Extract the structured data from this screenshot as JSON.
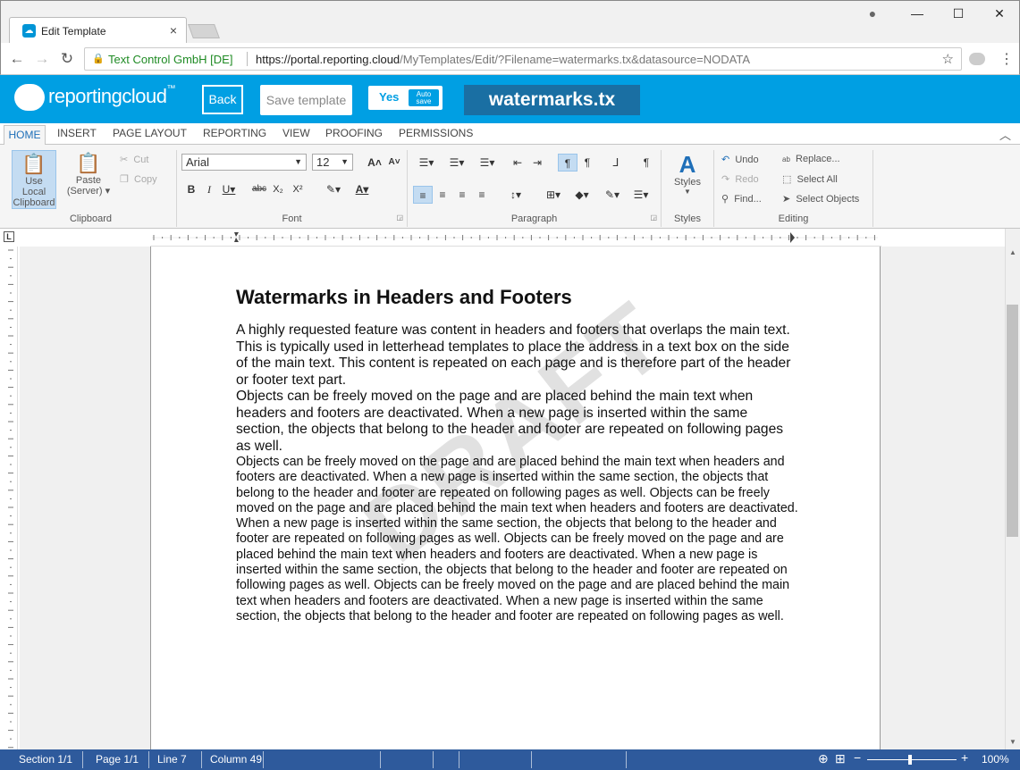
{
  "browser": {
    "tab_title": "Edit Template",
    "site_identity": "Text Control GmbH [DE]",
    "url_host": "https://portal.reporting.cloud",
    "url_path": "/MyTemplates/Edit/?Filename=watermarks.tx&datasource=NODATA"
  },
  "app": {
    "logo_text": "reportingcloud",
    "logo_tm": "™",
    "back_label": "Back",
    "save_label": "Save template",
    "autosave_yes": "Yes",
    "autosave_label1": "Auto",
    "autosave_label2": "save",
    "filename": "watermarks.tx"
  },
  "ribbon_tabs": [
    "HOME",
    "INSERT",
    "PAGE LAYOUT",
    "REPORTING",
    "VIEW",
    "PROOFING",
    "PERMISSIONS"
  ],
  "clipboard": {
    "use_local_1": "Use Local",
    "use_local_2": "Clipboard",
    "paste_1": "Paste",
    "paste_2": "(Server) ▾",
    "cut": "Cut",
    "copy": "Copy",
    "group": "Clipboard"
  },
  "font": {
    "name": "Arial",
    "size": "12",
    "group": "Font"
  },
  "paragraph": {
    "group": "Paragraph"
  },
  "styles": {
    "label": "Styles",
    "group": "Styles"
  },
  "editing": {
    "undo": "Undo",
    "redo": "Redo",
    "find": "Find...",
    "replace": "Replace...",
    "select_all": "Select All",
    "select_objects": "Select Objects",
    "group": "Editing"
  },
  "document": {
    "heading": "Watermarks in Headers and Footers",
    "p1": "A highly requested feature was content in headers and footers that overlaps the main text. This is typically used in letterhead templates to place the address in a text box on the side of the main text. This content is repeated on each page and is therefore part of the header or footer text part.",
    "p2": "Objects can be freely moved on the page and are placed behind the main text when headers and footers are deactivated. When a new page is inserted within the same section, the objects that belong to the header and footer are repeated on following pages as well.",
    "p3": "Objects can be freely moved on the page and are placed behind the main text when headers and footers are deactivated. When a new page is inserted within the same section, the objects that belong to the header and footer are repeated on following pages as well. Objects can be freely moved on the page and are placed behind the main text when headers and footers are deactivated. When a new page is inserted within the same section, the objects that belong to the header and footer are repeated on following pages as well. Objects can be freely moved on the page and are placed behind the main text when headers and footers are deactivated. When a new page is inserted within the same section, the objects that belong to the header and footer are repeated on following pages as well. Objects can be freely moved on the page and are placed behind the main text when headers and footers are deactivated. When a new page is inserted within the same section, the objects that belong to the header and footer are repeated on following pages as well.",
    "watermark": "DRAFT"
  },
  "status": {
    "section": "Section 1/1",
    "page": "Page 1/1",
    "line": "Line 7",
    "column": "Column 49",
    "zoom": "100%"
  },
  "colors": {
    "brand": "#009fe3",
    "filename_bg": "#1a6fa3",
    "status": "#2e5a9c"
  }
}
